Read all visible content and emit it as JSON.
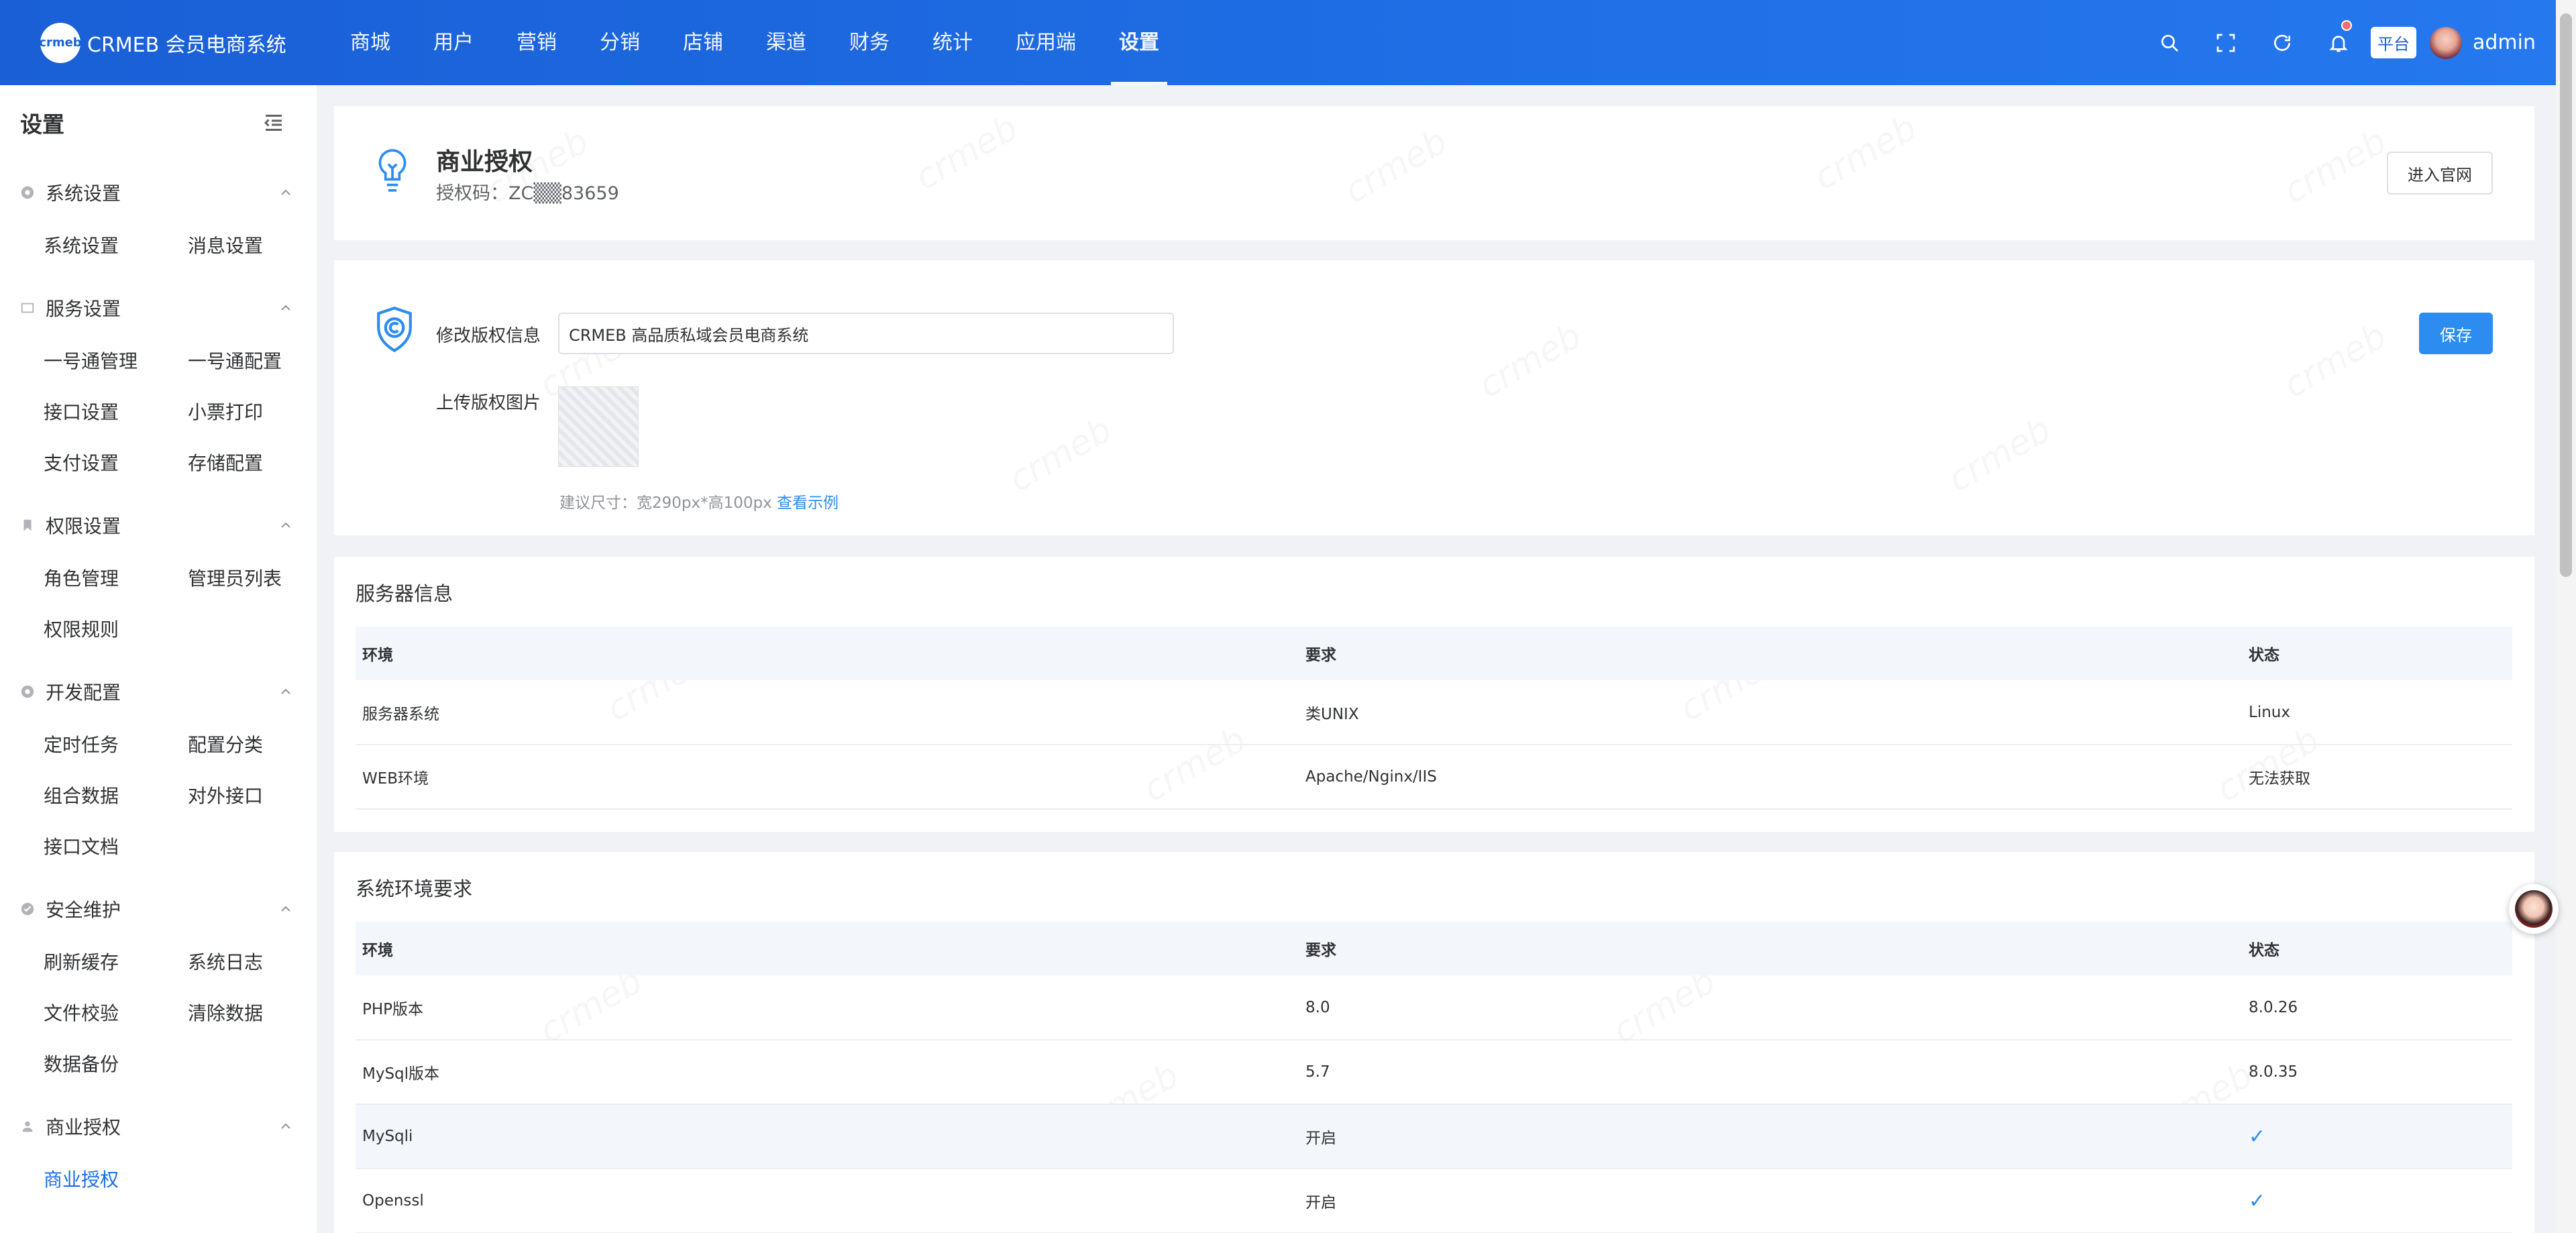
{
  "app": {
    "logo_mark": "crmeb",
    "title": "CRMEB 会员电商系统"
  },
  "topnav": [
    {
      "label": "商城"
    },
    {
      "label": "用户"
    },
    {
      "label": "营销"
    },
    {
      "label": "分销"
    },
    {
      "label": "店铺"
    },
    {
      "label": "渠道"
    },
    {
      "label": "财务"
    },
    {
      "label": "统计"
    },
    {
      "label": "应用端"
    },
    {
      "label": "设置",
      "active": true
    }
  ],
  "header_right": {
    "platform_tag": "平台",
    "username": "admin",
    "icons": [
      "search-icon",
      "fullscreen-icon",
      "refresh-icon",
      "bell-icon"
    ]
  },
  "sidebar": {
    "title": "设置",
    "groups": [
      {
        "label": "系统设置",
        "icon": "gear-icon",
        "items": [
          "系统设置",
          "消息设置"
        ]
      },
      {
        "label": "服务设置",
        "icon": "box-icon",
        "items": [
          "一号通管理",
          "一号通配置",
          "接口设置",
          "小票打印",
          "支付设置",
          "存储配置"
        ]
      },
      {
        "label": "权限设置",
        "icon": "bookmark-icon",
        "items": [
          "角色管理",
          "管理员列表",
          "权限规则"
        ]
      },
      {
        "label": "开发配置",
        "icon": "gear-icon",
        "items": [
          "定时任务",
          "配置分类",
          "组合数据",
          "对外接口",
          "接口文档"
        ]
      },
      {
        "label": "安全维护",
        "icon": "check-circle-icon",
        "items": [
          "刷新缓存",
          "系统日志",
          "文件校验",
          "清除数据",
          "数据备份"
        ]
      },
      {
        "label": "商业授权",
        "icon": "user-icon",
        "items": [
          "商业授权"
        ],
        "active_item": "商业授权"
      }
    ]
  },
  "license": {
    "title": "商业授权",
    "code_label": "授权码：",
    "code_value": "ZC▒▒83659",
    "official_button": "进入官网"
  },
  "copyright": {
    "label": "修改版权信息",
    "value": "CRMEB 高品质私域会员电商系统",
    "save_button": "保存",
    "upload_label": "上传版权图片",
    "hint": "建议尺寸：宽290px*高100px",
    "example_link": "查看示例"
  },
  "server_info": {
    "title": "服务器信息",
    "columns": [
      "环境",
      "要求",
      "状态"
    ],
    "rows": [
      [
        "服务器系统",
        "类UNIX",
        "Linux"
      ],
      [
        "WEB环境",
        "Apache/Nginx/IIS",
        "无法获取"
      ]
    ]
  },
  "env_requirements": {
    "title": "系统环境要求",
    "columns": [
      "环境",
      "要求",
      "状态"
    ],
    "rows": [
      [
        "PHP版本",
        "8.0",
        "8.0.26"
      ],
      [
        "MySql版本",
        "5.7",
        "8.0.35"
      ],
      [
        "MySqli",
        "开启",
        "✓"
      ],
      [
        "Openssl",
        "开启",
        "✓"
      ]
    ]
  },
  "watermark": "crmeb"
}
